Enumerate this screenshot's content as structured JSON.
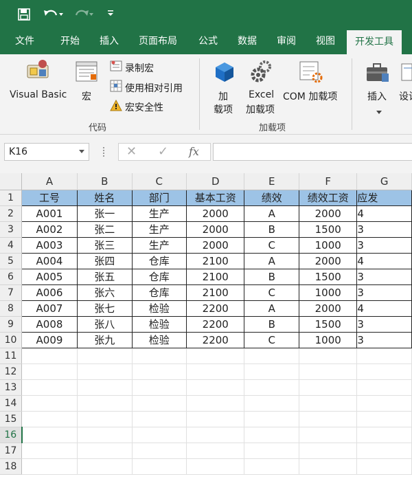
{
  "colors": {
    "accent": "#217346",
    "header_fill": "#9dc3e6"
  },
  "qat": {
    "icons": [
      "save-icon",
      "undo-icon",
      "redo-icon",
      "customize-icon"
    ]
  },
  "tabs": [
    "文件",
    "开始",
    "插入",
    "页面布局",
    "公式",
    "数据",
    "审阅",
    "视图",
    "开发工具"
  ],
  "active_tab": "开发工具",
  "ribbon": {
    "code": {
      "visual_basic": "Visual Basic",
      "macro": "宏",
      "record_macro": "录制宏",
      "relative_ref": "使用相对引用",
      "macro_security": "宏安全性",
      "label": "代码"
    },
    "addins": {
      "add1": "加",
      "add2": "载项",
      "excel1": "Excel",
      "excel2": "加载项",
      "com": "COM 加载项",
      "label": "加载项"
    },
    "controls": {
      "insert": "插入",
      "design": "设计"
    }
  },
  "formula_bar": {
    "name_box": "K16",
    "fx": "fx",
    "value": ""
  },
  "grid": {
    "columns": [
      "A",
      "B",
      "C",
      "D",
      "E",
      "F",
      "G"
    ],
    "rows": [
      [
        "工号",
        "姓名",
        "部门",
        "基本工资",
        "绩效",
        "绩效工资",
        "应发"
      ],
      [
        "A001",
        "张一",
        "生产",
        "2000",
        "A",
        "2000",
        "4"
      ],
      [
        "A002",
        "张二",
        "生产",
        "2000",
        "B",
        "1500",
        "3"
      ],
      [
        "A003",
        "张三",
        "生产",
        "2000",
        "C",
        "1000",
        "3"
      ],
      [
        "A004",
        "张四",
        "仓库",
        "2100",
        "A",
        "2000",
        "4"
      ],
      [
        "A005",
        "张五",
        "仓库",
        "2100",
        "B",
        "1500",
        "3"
      ],
      [
        "A006",
        "张六",
        "仓库",
        "2100",
        "C",
        "1000",
        "3"
      ],
      [
        "A007",
        "张七",
        "检验",
        "2200",
        "A",
        "2000",
        "4"
      ],
      [
        "A008",
        "张八",
        "检验",
        "2200",
        "B",
        "1500",
        "3"
      ],
      [
        "A009",
        "张九",
        "检验",
        "2200",
        "C",
        "1000",
        "3"
      ]
    ],
    "empty_rows": [
      11,
      12,
      13,
      14,
      15,
      16,
      17,
      18
    ],
    "selected_row": 16
  }
}
